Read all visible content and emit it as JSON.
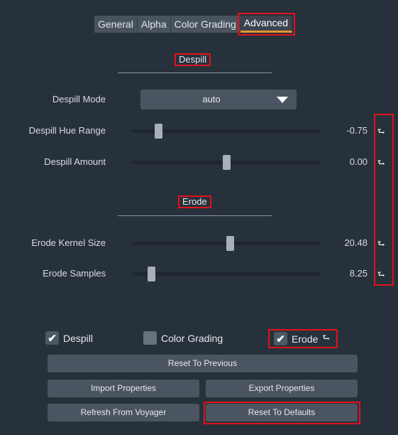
{
  "tabs": [
    {
      "label": "General"
    },
    {
      "label": "Alpha"
    },
    {
      "label": "Color Grading"
    },
    {
      "label": "Advanced"
    }
  ],
  "despill_section": {
    "title": "Despill",
    "mode_label": "Despill Mode",
    "mode_value": "auto",
    "hue_range_label": "Despill Hue Range",
    "hue_range_value": "-0.75",
    "amount_label": "Despill Amount",
    "amount_value": "0.00"
  },
  "erode_section": {
    "title": "Erode",
    "kernel_label": "Erode Kernel Size",
    "kernel_value": "20.48",
    "samples_label": "Erode Samples",
    "samples_value": "8.25"
  },
  "slider_levels": {
    "hue_range": 0.14,
    "amount": 0.5,
    "kernel": 0.52,
    "samples": 0.1
  },
  "reset_icon": "⮑",
  "checkboxes": {
    "despill": {
      "label": "Despill",
      "checked": true
    },
    "color_grading": {
      "label": "Color Grading",
      "checked": false
    },
    "erode": {
      "label": "Erode",
      "checked": true
    }
  },
  "buttons": {
    "reset_previous": "Reset To Previous",
    "import_properties": "Import Properties",
    "export_properties": "Export Properties",
    "refresh_voyager": "Refresh From Voyager",
    "reset_defaults": "Reset To Defaults"
  },
  "colors": {
    "accent": "#e0982e",
    "highlight": "#e2121c",
    "background": "#27313b"
  }
}
